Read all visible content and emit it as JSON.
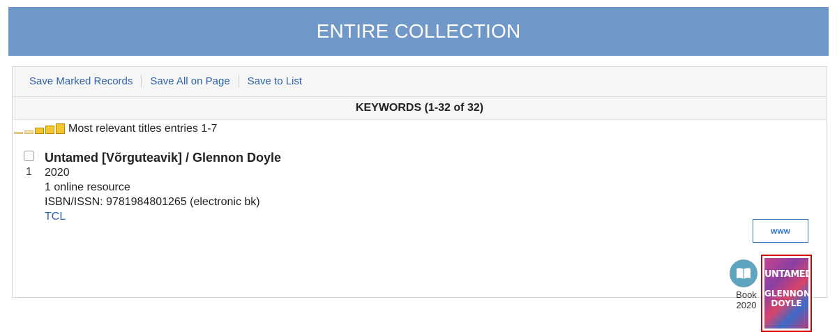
{
  "banner": {
    "title": "ENTIRE COLLECTION"
  },
  "toolbar": {
    "save_marked": "Save Marked Records",
    "save_all": "Save All on Page",
    "save_list": "Save to List"
  },
  "results": {
    "header": "KEYWORDS (1-32 of 32)"
  },
  "relevance": {
    "label": "Most relevant titles entries 1-7"
  },
  "record": {
    "number": "1",
    "title": "Untamed [Võrguteavik] / Glennon Doyle",
    "year": "2020",
    "description": "1 online resource",
    "isbn": "ISBN/ISSN:  9781984801265 (electronic bk)",
    "location": "TCL",
    "www_label": "www",
    "format_icon": "book-icon",
    "format_type": "Book",
    "format_year": "2020",
    "cover": {
      "title": "UNTAMED",
      "author_line1": "GLENNON",
      "author_line2": "DOYLE"
    }
  },
  "colors": {
    "banner": "#6f98c8",
    "link": "#2f63a8",
    "highlight_frame": "#d60000",
    "format_icon_bg": "#5fa5c0"
  }
}
